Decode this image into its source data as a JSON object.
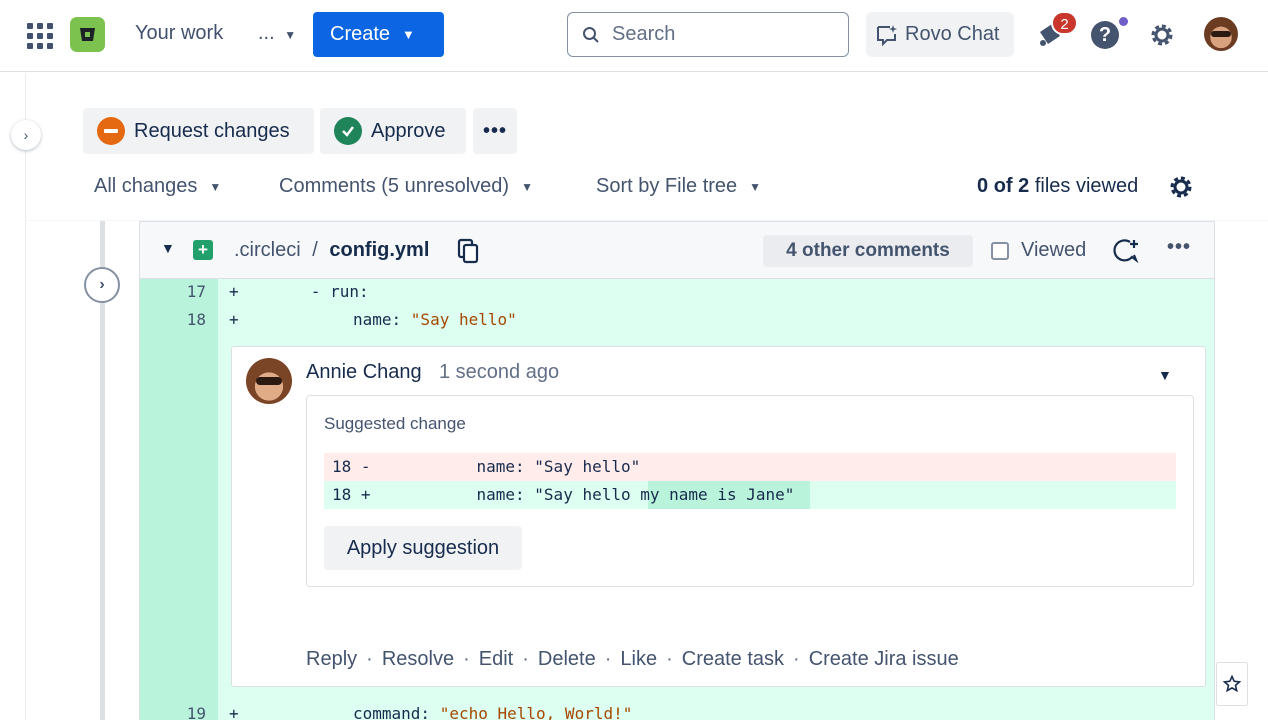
{
  "topnav": {
    "your_work": "Your work",
    "more": "...",
    "create": "Create",
    "search_placeholder": "Search",
    "rovo_chat": "Rovo Chat",
    "notification_count": "2",
    "help": "?"
  },
  "pr_actions": {
    "request_changes": "Request changes",
    "approve": "Approve",
    "more": "•••"
  },
  "filters": {
    "changes": "All changes",
    "comments": "Comments (5 unresolved)",
    "sort": "Sort by File tree"
  },
  "files_viewed": {
    "viewed": "0",
    "of_label": "of",
    "total": "2",
    "suffix": "files viewed"
  },
  "file": {
    "dir": ".circleci",
    "slash": "/",
    "name": "config.yml",
    "other_comments": "4 other comments",
    "viewed_label": "Viewed",
    "more": "•••"
  },
  "diff_lines": [
    {
      "no": "17",
      "sign": "+",
      "code": "      - run:"
    },
    {
      "no": "18",
      "sign": "+",
      "key": "name: ",
      "str": "\"Say hello\""
    },
    {
      "no": "19",
      "sign": "+",
      "key": "command: ",
      "str": "\"echo Hello, World!\""
    }
  ],
  "comment": {
    "author": "Annie Chang",
    "time": "1 second ago",
    "suggestion_title": "Suggested change",
    "old_line": "18 -           name: \"Say hello\"",
    "new_line": "18 +           name: \"Say hello my name is Jane\"",
    "apply": "Apply suggestion",
    "actions": [
      "Reply",
      "Resolve",
      "Edit",
      "Delete",
      "Like",
      "Create task",
      "Create Jira issue"
    ]
  },
  "colors": {
    "primary": "#0c66e4",
    "added_gutter": "#baf3db",
    "added_bg": "#dcfff1",
    "removed_bg": "#ffeceb",
    "approve": "#1f845a",
    "request_changes": "#e56910",
    "badge": "#c9372c"
  }
}
